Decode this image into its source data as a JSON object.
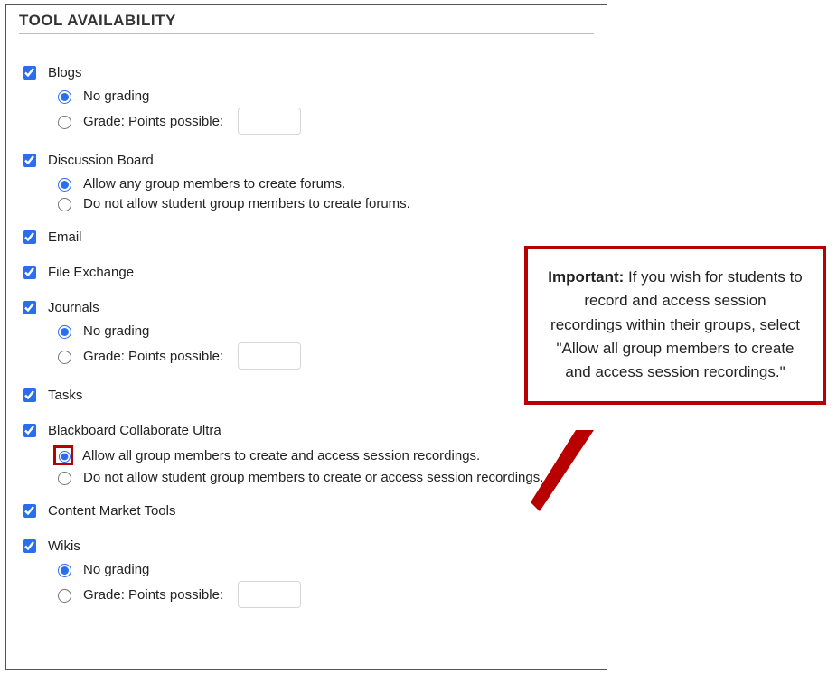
{
  "section_title": "TOOL AVAILABILITY",
  "tools": {
    "blogs": {
      "label": "Blogs",
      "no_grading": "No grading",
      "grade_label": "Grade: Points possible:"
    },
    "discussion": {
      "label": "Discussion Board",
      "opt_allow": "Allow any group members to create forums.",
      "opt_deny": "Do not allow student group members to create forums."
    },
    "email": {
      "label": "Email"
    },
    "file_exchange": {
      "label": "File Exchange"
    },
    "journals": {
      "label": "Journals",
      "no_grading": "No grading",
      "grade_label": "Grade: Points possible:"
    },
    "tasks": {
      "label": "Tasks"
    },
    "collab": {
      "label": "Blackboard Collaborate Ultra",
      "opt_allow": "Allow all group members to create and access session recordings.",
      "opt_deny": "Do not allow student group members to create or access session recordings."
    },
    "content_market": {
      "label": "Content Market Tools"
    },
    "wikis": {
      "label": "Wikis",
      "no_grading": "No grading",
      "grade_label": "Grade: Points possible:"
    }
  },
  "callout": {
    "strong": "Important:",
    "text": " If you wish for students to record and access session recordings within their groups, select \"Allow all group members to create and access session recordings.\""
  }
}
